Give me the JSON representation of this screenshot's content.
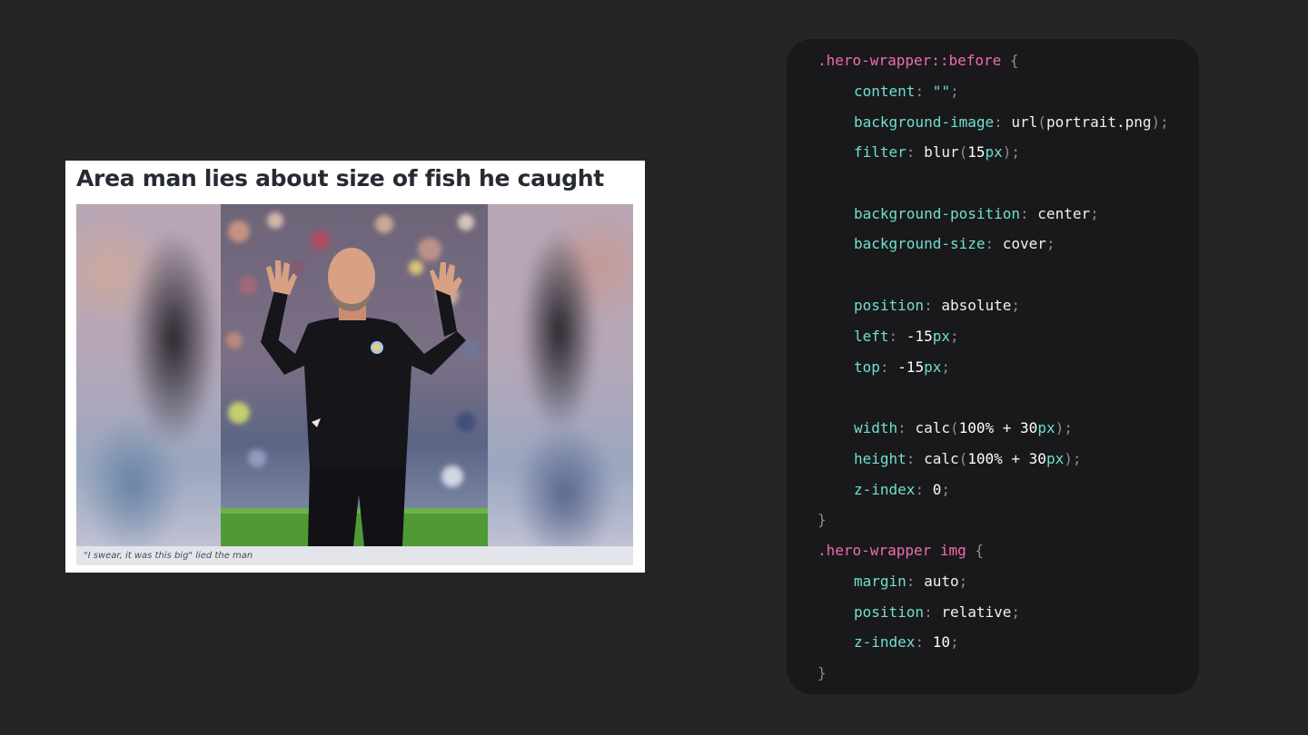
{
  "article": {
    "headline": "Area man lies about size of fish he caught",
    "caption": "\"I swear, it was this big\" lied the man",
    "image_subject": "man-waving-on-football-pitch"
  },
  "code": {
    "lines": [
      {
        "indent": false,
        "tokens": [
          [
            "sel",
            ".hero-wrapper::before"
          ],
          [
            "punc",
            " {"
          ]
        ]
      },
      {
        "indent": true,
        "tokens": [
          [
            "prop",
            "content"
          ],
          [
            "punc",
            ": "
          ],
          [
            "str",
            "\"\""
          ],
          [
            "punc",
            ";"
          ]
        ]
      },
      {
        "indent": true,
        "tokens": [
          [
            "prop",
            "background-image"
          ],
          [
            "punc",
            ": "
          ],
          [
            "val",
            "url"
          ],
          [
            "punc",
            "("
          ],
          [
            "val",
            "portrait.png"
          ],
          [
            "punc",
            ");"
          ]
        ]
      },
      {
        "indent": true,
        "tokens": [
          [
            "prop",
            "filter"
          ],
          [
            "punc",
            ": "
          ],
          [
            "val",
            "blur"
          ],
          [
            "punc",
            "("
          ],
          [
            "num",
            "15"
          ],
          [
            "unit",
            "px"
          ],
          [
            "punc",
            ");"
          ]
        ]
      },
      {
        "indent": true,
        "tokens": [
          [
            "prop",
            "background-position"
          ],
          [
            "punc",
            ": "
          ],
          [
            "val",
            "center"
          ],
          [
            "punc",
            ";"
          ]
        ]
      },
      {
        "indent": true,
        "tokens": [
          [
            "prop",
            "background-size"
          ],
          [
            "punc",
            ": "
          ],
          [
            "val",
            "cover"
          ],
          [
            "punc",
            ";"
          ]
        ]
      },
      {
        "indent": true,
        "tokens": [
          [
            "prop",
            "position"
          ],
          [
            "punc",
            ": "
          ],
          [
            "val",
            "absolute"
          ],
          [
            "punc",
            ";"
          ]
        ]
      },
      {
        "indent": true,
        "tokens": [
          [
            "prop",
            "left"
          ],
          [
            "punc",
            ": "
          ],
          [
            "num",
            "-15"
          ],
          [
            "unit",
            "px"
          ],
          [
            "punc",
            ";"
          ]
        ]
      },
      {
        "indent": true,
        "tokens": [
          [
            "prop",
            "top"
          ],
          [
            "punc",
            ": "
          ],
          [
            "num",
            "-15"
          ],
          [
            "unit",
            "px"
          ],
          [
            "punc",
            ";"
          ]
        ]
      },
      {
        "indent": true,
        "tokens": [
          [
            "prop",
            "width"
          ],
          [
            "punc",
            ": "
          ],
          [
            "val",
            "calc"
          ],
          [
            "punc",
            "("
          ],
          [
            "num",
            "100%"
          ],
          [
            "val",
            " + "
          ],
          [
            "num",
            "30"
          ],
          [
            "unit",
            "px"
          ],
          [
            "punc",
            ");"
          ]
        ]
      },
      {
        "indent": true,
        "tokens": [
          [
            "prop",
            "height"
          ],
          [
            "punc",
            ": "
          ],
          [
            "val",
            "calc"
          ],
          [
            "punc",
            "("
          ],
          [
            "num",
            "100%"
          ],
          [
            "val",
            " + "
          ],
          [
            "num",
            "30"
          ],
          [
            "unit",
            "px"
          ],
          [
            "punc",
            ");"
          ]
        ]
      },
      {
        "indent": true,
        "tokens": [
          [
            "prop",
            "z-index"
          ],
          [
            "punc",
            ": "
          ],
          [
            "num",
            "0"
          ],
          [
            "punc",
            ";"
          ]
        ]
      },
      {
        "indent": false,
        "tokens": [
          [
            "punc",
            "}"
          ]
        ]
      },
      {
        "indent": false,
        "tokens": [
          [
            "sel",
            ".hero-wrapper img"
          ],
          [
            "punc",
            " {"
          ]
        ]
      },
      {
        "indent": true,
        "tokens": [
          [
            "prop",
            "margin"
          ],
          [
            "punc",
            ": "
          ],
          [
            "val",
            "auto"
          ],
          [
            "punc",
            ";"
          ]
        ]
      },
      {
        "indent": true,
        "tokens": [
          [
            "prop",
            "position"
          ],
          [
            "punc",
            ": "
          ],
          [
            "val",
            "relative"
          ],
          [
            "punc",
            ";"
          ]
        ]
      },
      {
        "indent": true,
        "tokens": [
          [
            "prop",
            "z-index"
          ],
          [
            "punc",
            ": "
          ],
          [
            "num",
            "10"
          ],
          [
            "punc",
            ";"
          ]
        ]
      },
      {
        "indent": false,
        "tokens": [
          [
            "punc",
            "}"
          ]
        ]
      }
    ]
  },
  "colors": {
    "page_background": "#242525",
    "code_background": "#19191b",
    "selector": "#f06bb0",
    "property": "#6fe0cf",
    "punctuation": "#8c8c92",
    "value": "#f1f1f1",
    "headline": "#262a33",
    "caption_background": "#e3e5ea"
  }
}
